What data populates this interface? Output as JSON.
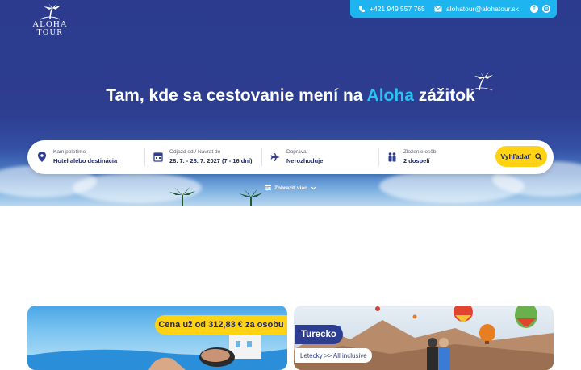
{
  "header": {
    "logo_line1": "ALOHA",
    "logo_line2": "TOUR",
    "phone": "+421 949 557 765",
    "email": "alohatour@alohatour.sk",
    "social": [
      "facebook-icon",
      "instagram-icon"
    ]
  },
  "hero": {
    "headline_before": "Tam, kde sa cestovanie mení na ",
    "headline_accent": "Aloha",
    "headline_after": " zážitok"
  },
  "search": {
    "destination": {
      "label": "Kam poletíme",
      "value": "Hotel alebo destinácia",
      "icon": "location-pin-icon"
    },
    "dates": {
      "label": "Odjazd od / Návrat do",
      "value": "28. 7. - 28. 7. 2027 (7 - 16 dní)",
      "icon": "calendar-icon"
    },
    "transport": {
      "label": "Doprava",
      "value": "Nerozhoduje",
      "icon": "airplane-icon"
    },
    "persons": {
      "label": "Zloženie osôb",
      "value": "2 dospelí",
      "icon": "people-icon"
    },
    "button": "Vyhľadať",
    "more": "Zobraziť viac"
  },
  "offers": [
    {
      "price_badge": "Cena už od 312,83 € za osobu"
    },
    {
      "country": "Turecko",
      "subtitle": "Letecky >> All inclusive"
    }
  ],
  "colors": {
    "brand": "#2d3d90",
    "accent": "#1eb4ef",
    "highlight": "#2bc3f3",
    "button": "#ffd313"
  }
}
